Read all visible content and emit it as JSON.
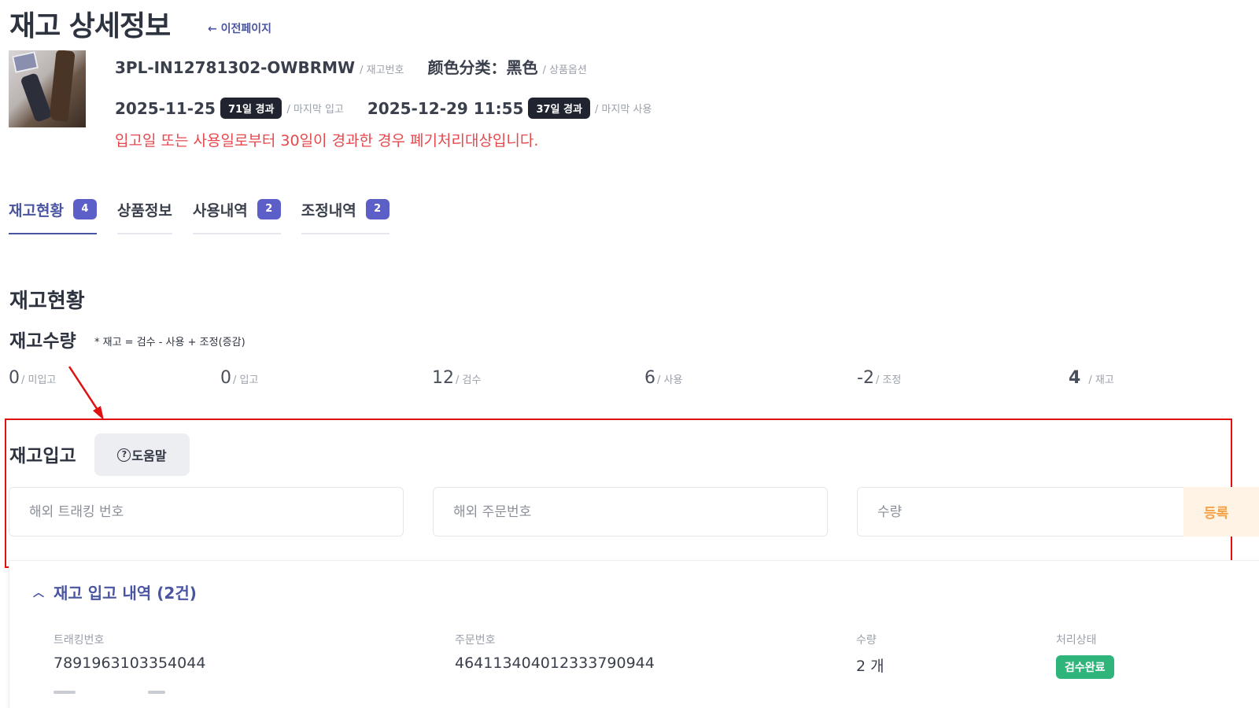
{
  "page": {
    "title": "재고 상세정보",
    "back_label": "← 이전페이지"
  },
  "item": {
    "stock_code": "3PL-IN12781302-OWBRMW",
    "stock_code_label": "/ 재고번호",
    "option": "颜色分类：黑色",
    "option_label": "/ 상품옵션",
    "last_inbound_date": "2025-11-25",
    "last_inbound_badge": "71일 경과",
    "last_inbound_label": "/ 마지막 입고",
    "last_use_date": "2025-12-29 11:55",
    "last_use_badge": "37일 경과",
    "last_use_label": "/ 마지막 사용",
    "warning": "입고일 또는 사용일로부터 30일이 경과한 경우 폐기처리대상입니다."
  },
  "tabs": [
    {
      "label": "재고현황",
      "count": "4"
    },
    {
      "label": "상품정보",
      "count": ""
    },
    {
      "label": "사용내역",
      "count": "2"
    },
    {
      "label": "조정내역",
      "count": "2"
    }
  ],
  "status_section": {
    "title": "재고현황",
    "qty_title": "재고수량",
    "formula": "* 재고 = 검수 - 사용 + 조정(증감)",
    "stats": [
      {
        "value": "0",
        "label": "/ 미입고"
      },
      {
        "value": "0",
        "label": "/ 입고"
      },
      {
        "value": "12",
        "label": "/ 검수"
      },
      {
        "value": "6",
        "label": "/ 사용"
      },
      {
        "value": "-2",
        "label": "/ 조정"
      },
      {
        "value": "4",
        "label": "/ 재고"
      }
    ]
  },
  "inbound": {
    "title": "재고입고",
    "help_label": "도움말",
    "tracking_placeholder": "해외 트래킹 번호",
    "order_placeholder": "해외 주문번호",
    "qty_placeholder": "수량",
    "register_label": "등록"
  },
  "history": {
    "title": "재고 입고 내역 (2건)",
    "columns": [
      "트래킹번호",
      "주문번호",
      "수량",
      "처리상태"
    ],
    "rows": [
      {
        "tracking": "7891963103354044",
        "order": "4641134040123337909 44",
        "qty": "2 개",
        "status": "검수완료"
      }
    ]
  },
  "colors": {
    "accent": "#4a55a2",
    "badge": "#5b5fc7",
    "warning": "#e5484d",
    "success": "#2fb57a",
    "highlight_border": "#e01010"
  }
}
